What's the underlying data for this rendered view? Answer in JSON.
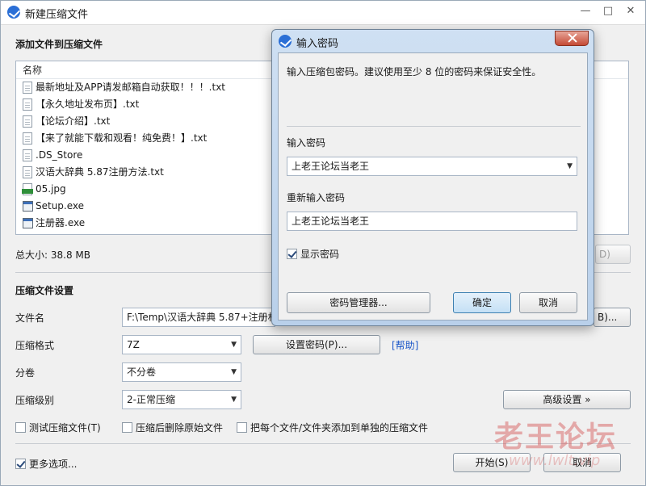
{
  "main": {
    "title": "新建压缩文件",
    "title_buttons": {
      "minimize": "—",
      "maximize": "□",
      "close": "✕"
    },
    "add_files_heading": "添加文件到压缩文件",
    "list": {
      "column_name": "名称",
      "files": [
        {
          "name": "最新地址及APP请发邮箱自动获取！！！.txt",
          "icon": "text-file-icon"
        },
        {
          "name": "【永久地址发布页】.txt",
          "icon": "text-file-icon"
        },
        {
          "name": "【论坛介绍】.txt",
          "icon": "text-file-icon"
        },
        {
          "name": "【来了就能下载和观看！纯免费！】.txt",
          "icon": "text-file-icon"
        },
        {
          "name": ".DS_Store",
          "icon": "text-file-icon"
        },
        {
          "name": "汉语大辞典 5.87注册方法.txt",
          "icon": "text-file-icon"
        },
        {
          "name": "05.jpg",
          "icon": "jpg-file-icon"
        },
        {
          "name": "Setup.exe",
          "icon": "exe-file-icon"
        },
        {
          "name": "注册器.exe",
          "icon": "exe-file-icon"
        }
      ]
    },
    "total_size": "总大小: 38.8 MB",
    "list_side_button": "D)",
    "settings_heading": "压缩文件设置",
    "filename_label": "文件名",
    "filename_value": "F:\\Temp\\汉语大辞典 5.87+注册机",
    "browse_button": "B)...",
    "format_label": "压缩格式",
    "format_value": "7Z",
    "set_password_button": "设置密码(P)...",
    "help_link": "[帮助]",
    "volume_label": "分卷",
    "volume_value": "不分卷",
    "level_label": "压缩级别",
    "level_value": "2-正常压缩",
    "advanced_button": "高级设置 »",
    "checkboxes": {
      "test": "测试压缩文件(T)",
      "delete_after": "压缩后删除原始文件",
      "separate": "把每个文件/文件夹添加到单独的压缩文件"
    },
    "more_options": "更多选项...",
    "start_button": "开始(S)",
    "cancel_button": "取消"
  },
  "dialog": {
    "title": "输入密码",
    "description": "输入压缩包密码。建议使用至少 8 位的密码来保证安全性。",
    "password_label": "输入密码",
    "password_value": "上老王论坛当老王",
    "confirm_label": "重新输入密码",
    "confirm_value": "上老王论坛当老王",
    "show_password": "显示密码",
    "manager_button": "密码管理器...",
    "ok_button": "确定",
    "cancel_button": "取消"
  },
  "watermark": {
    "text": "老王论坛",
    "url": "www.lwlt.vip"
  }
}
